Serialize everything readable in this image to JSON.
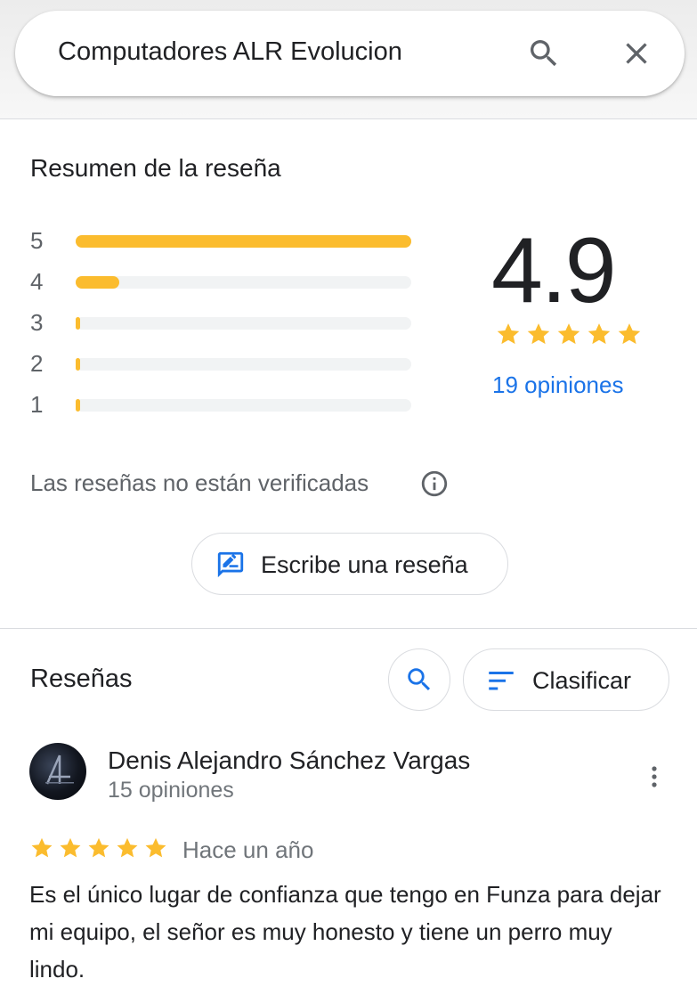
{
  "search": {
    "query": "Computadores ALR Evolucion"
  },
  "summary": {
    "title": "Resumen de la reseña",
    "distribution": [
      {
        "stars": "5",
        "fraction": 1.0
      },
      {
        "stars": "4",
        "fraction": 0.13
      },
      {
        "stars": "3",
        "fraction": 0.01
      },
      {
        "stars": "2",
        "fraction": 0.01
      },
      {
        "stars": "1",
        "fraction": 0.01
      }
    ],
    "score": "4.9",
    "star_count": 5,
    "total": "19 opiniones",
    "unverified_note": "Las reseñas no están verificadas",
    "write_label": "Escribe una reseña"
  },
  "reviews": {
    "title": "Reseñas",
    "sort_label": "Clasificar",
    "items": [
      {
        "name": "Denis Alejandro Sánchez Vargas",
        "count": "15 opiniones",
        "rating": 5,
        "date": "Hace un año",
        "text": "Es el único lugar de confianza que tengo en Funza para dejar mi equipo, el señor es muy honesto y tiene un perro muy lindo."
      }
    ]
  },
  "colors": {
    "star": "#fbbc2e",
    "link": "#1a73e8",
    "track": "#f1f3f4"
  }
}
